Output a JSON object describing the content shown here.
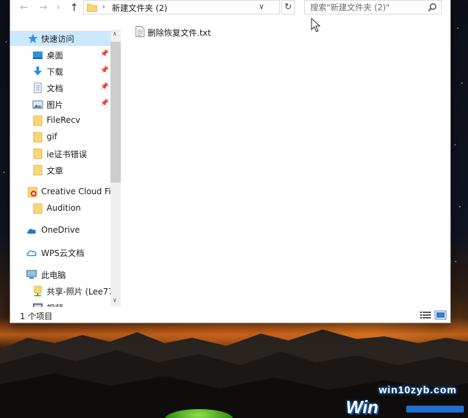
{
  "explorer": {
    "address": {
      "path": "新建文件夹 (2)"
    },
    "search": {
      "placeholder": "搜索\"新建文件夹 (2)\""
    },
    "sidebar": {
      "quick_access": "快速访问",
      "items": [
        {
          "label": "桌面",
          "icon": "desktop-icon",
          "pinned": true
        },
        {
          "label": "下载",
          "icon": "download-icon",
          "pinned": true
        },
        {
          "label": "文档",
          "icon": "document-icon",
          "pinned": true
        },
        {
          "label": "图片",
          "icon": "pictures-icon",
          "pinned": true
        },
        {
          "label": "FileRecv",
          "icon": "folder-icon",
          "pinned": false
        },
        {
          "label": "gif",
          "icon": "folder-icon",
          "pinned": false
        },
        {
          "label": "ie证书错误",
          "icon": "folder-icon",
          "pinned": false
        },
        {
          "label": "文章",
          "icon": "folder-icon",
          "pinned": false
        }
      ],
      "creative_cloud": "Creative Cloud Fil",
      "audition": "Audition",
      "onedrive": "OneDrive",
      "wps": "WPS云文档",
      "this_pc": "此电脑",
      "shared": "共享-照片 (Lee77",
      "videos": "视频"
    },
    "files": [
      {
        "name": "删除恢复文件.txt",
        "icon": "text-file-icon"
      }
    ],
    "status": {
      "item_count": "1 个项目"
    }
  },
  "watermark": {
    "url": "win10zyb.com",
    "logo": "Win"
  },
  "colors": {
    "selection": "#cce8ff",
    "folder": "#f8d775",
    "accent_blue": "#1f6fd0"
  }
}
